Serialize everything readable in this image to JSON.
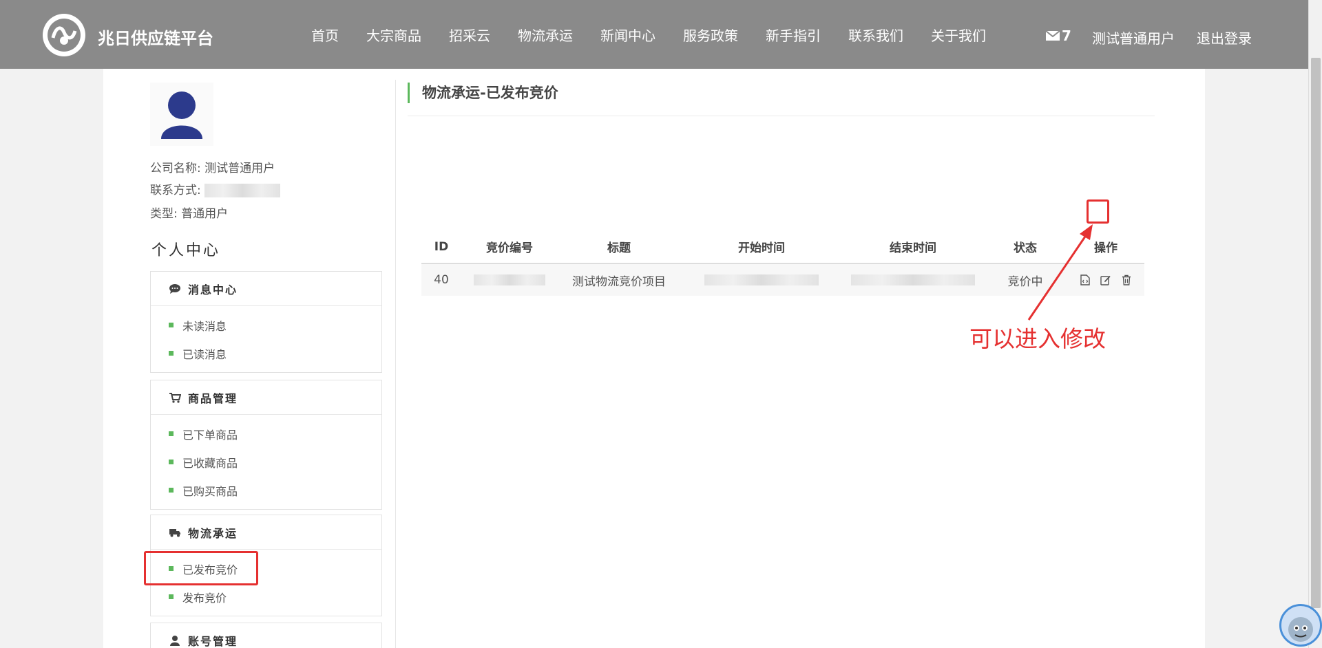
{
  "header": {
    "brand": "兆日供应链平台",
    "nav": [
      "首页",
      "大宗商品",
      "招采云",
      "物流承运",
      "新闻中心",
      "服务政策",
      "新手指引",
      "联系我们",
      "关于我们"
    ],
    "mail_count": "7",
    "username": "测试普通用户",
    "logout": "退出登录"
  },
  "profile": {
    "company_label": "公司名称:",
    "company_value": "测试普通用户",
    "contact_label": "联系方式:",
    "type_label": "类型:",
    "type_value": "普通用户"
  },
  "sidebar": {
    "title": "个人中心",
    "sections": [
      {
        "title": "消息中心",
        "icon": "comment-icon",
        "items": [
          "未读消息",
          "已读消息"
        ]
      },
      {
        "title": "商品管理",
        "icon": "cart-icon",
        "items": [
          "已下单商品",
          "已收藏商品",
          "已购买商品"
        ]
      },
      {
        "title": "物流承运",
        "icon": "truck-icon",
        "items": [
          "已发布竞价",
          "发布竞价"
        ]
      },
      {
        "title": "账号管理",
        "icon": "user-icon",
        "items": []
      }
    ]
  },
  "main": {
    "title": "物流承运-已发布竞价",
    "table": {
      "headers": [
        "ID",
        "竞价编号",
        "标题",
        "开始时间",
        "结束时间",
        "状态",
        "操作"
      ],
      "rows": [
        {
          "id": "40",
          "title": "测试物流竞价项目",
          "status": "竞价中"
        }
      ]
    }
  },
  "annotation": {
    "text": "可以进入修改",
    "color": "#e53030"
  },
  "colors": {
    "header_bg": "#8a8a8a",
    "accent_green": "#5cb85c"
  }
}
